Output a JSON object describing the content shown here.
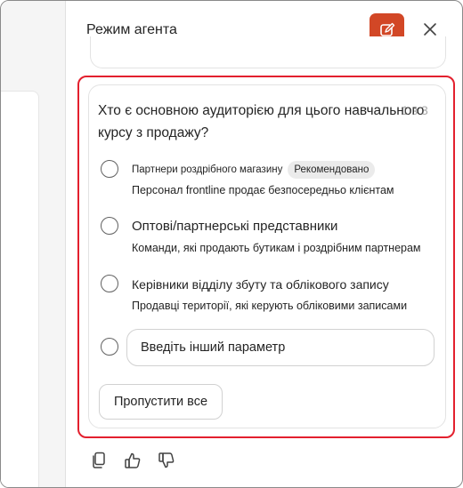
{
  "header": {
    "title": "Режим агента"
  },
  "question": {
    "text": "Хто є основною аудиторією для цього навчального курсу з продажу?",
    "counter": "1 з 3"
  },
  "options": [
    {
      "label": "Партнери роздрібного магазину",
      "badge": "Рекомендовано",
      "description": "Персонал frontline продає безпосередньо клієнтам"
    },
    {
      "label": "Оптові/партнерські представники",
      "description": "Команди, які продають бутикам і роздрібним партнерам"
    },
    {
      "label": "Керівники відділу збуту та облікового запису",
      "description": "Продавці території, які керують обліковими записами"
    }
  ],
  "other_option": {
    "placeholder": "Введіть інший параметр"
  },
  "skip_all_label": "Пропустити все",
  "colors": {
    "accent": "#d24726",
    "highlight": "#e3202e"
  },
  "icons": [
    "new-chat-icon",
    "close-icon",
    "copy-icon",
    "thumbs-up-icon",
    "thumbs-down-icon"
  ]
}
